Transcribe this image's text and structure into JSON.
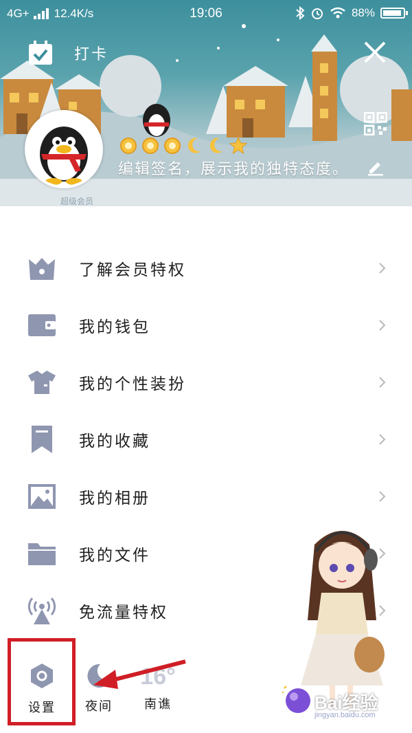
{
  "status_bar": {
    "network": "4G+",
    "speed": "12.4K/s",
    "time": "19:06",
    "battery": "88%"
  },
  "header": {
    "checkin_label": "打卡",
    "signature": "编辑签名，展示我的独特态度。",
    "level_icons": [
      "sun-icon",
      "sun-icon",
      "sun-icon",
      "moon-icon",
      "moon-icon",
      "star-icon"
    ],
    "faint_text": "超级会员"
  },
  "menu": {
    "items": [
      {
        "label": "了解会员特权",
        "icon": "crown-icon"
      },
      {
        "label": "我的钱包",
        "icon": "wallet-icon"
      },
      {
        "label": "我的个性装扮",
        "icon": "shirt-icon"
      },
      {
        "label": "我的收藏",
        "icon": "bookmark-icon"
      },
      {
        "label": "我的相册",
        "icon": "photo-icon"
      },
      {
        "label": "我的文件",
        "icon": "folder-icon"
      },
      {
        "label": "免流量特权",
        "icon": "broadcast-icon"
      }
    ]
  },
  "bottom_bar": {
    "settings_label": "设置",
    "night_label": "夜间",
    "weather_temp": "16°",
    "weather_city": "南谯"
  },
  "watermark": {
    "brand": "Bai经验",
    "url": "jingyan.baidu.com"
  },
  "colors": {
    "icon_gray": "#8f96b0",
    "highlight_red": "#d01e26",
    "header_teal": "#3d8f9d"
  }
}
